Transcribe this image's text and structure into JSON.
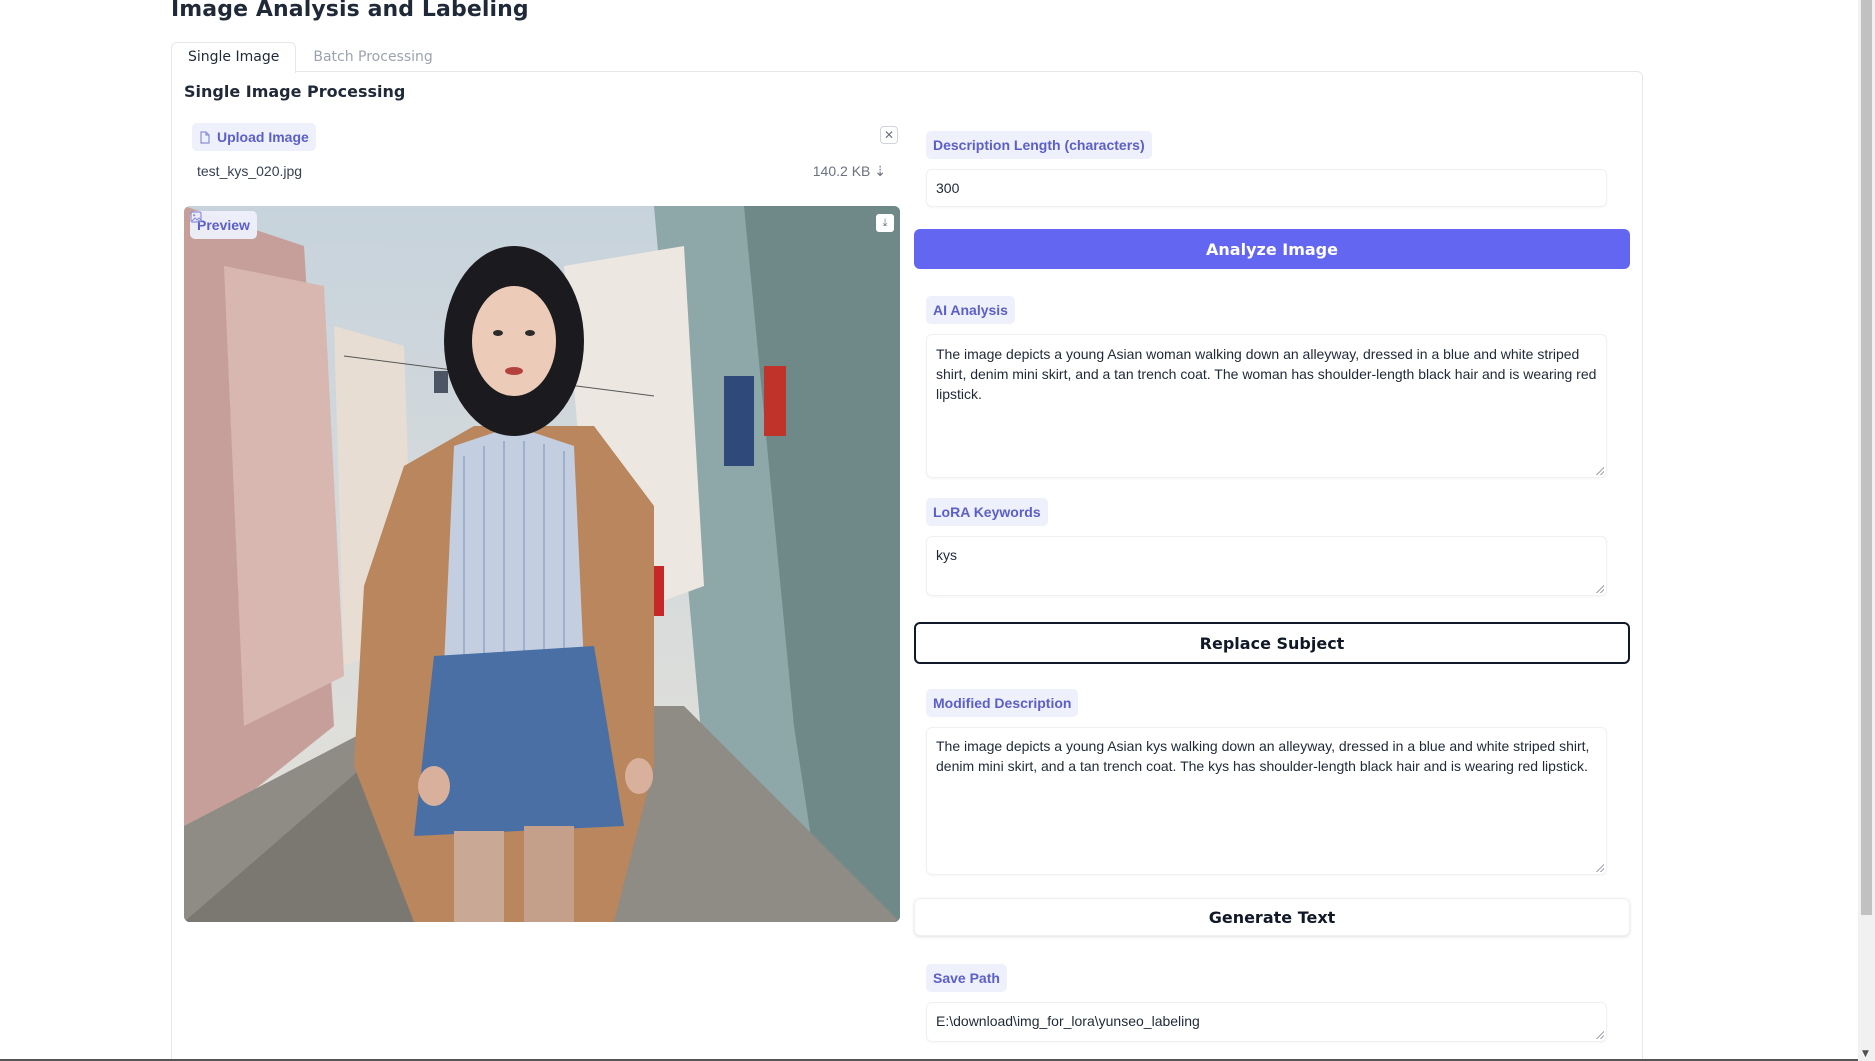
{
  "page": {
    "title": "Image Analysis and Labeling"
  },
  "tabs": [
    {
      "label": "Single Image",
      "active": true
    },
    {
      "label": "Batch Processing",
      "active": false
    }
  ],
  "single": {
    "section_title": "Single Image Processing",
    "upload": {
      "label": "Upload Image",
      "file_name": "test_kys_020.jpg",
      "file_size": "140.2 KB ⇣"
    },
    "preview": {
      "label": "Preview"
    },
    "description_length": {
      "label": "Description Length (characters)",
      "value": "300"
    },
    "analyze_button": "Analyze Image",
    "ai_analysis": {
      "label": "AI Analysis",
      "value": "The image depicts a young Asian woman walking down an alleyway, dressed in a blue and white striped shirt, denim mini skirt, and a tan trench coat. The woman has shoulder-length black hair and is wearing red lipstick."
    },
    "lora_keywords": {
      "label": "LoRA Keywords",
      "value": "kys"
    },
    "replace_button": "Replace Subject",
    "modified_description": {
      "label": "Modified Description",
      "value": "The image depicts a young Asian kys walking down an alleyway, dressed in a blue and white striped shirt, denim mini skirt, and a tan trench coat. The kys has shoulder-length black hair and is wearing red lipstick."
    },
    "generate_button": "Generate Text",
    "save_path": {
      "label": "Save Path",
      "value": "E:\\download\\img_for_lora\\yunseo_labeling"
    }
  },
  "colors": {
    "accent": "#6366f1",
    "chip_bg": "#eef0fb",
    "chip_text": "#5b5fc7"
  }
}
